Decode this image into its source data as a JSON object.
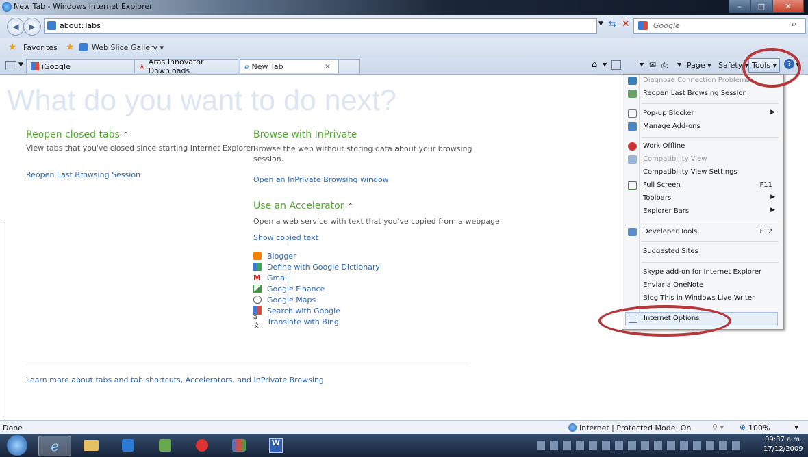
{
  "window": {
    "title": "New Tab - Windows Internet Explorer"
  },
  "address": {
    "url": "about:Tabs",
    "search_placeholder": "Google"
  },
  "favorites": {
    "favorites_label": "Favorites",
    "web_slice_label": "Web Slice Gallery ▾"
  },
  "tabs": [
    {
      "label": "iGoogle"
    },
    {
      "label": "Aras Innovator Downloads"
    },
    {
      "label": "New Tab"
    }
  ],
  "command_bar": {
    "page": "Page ▾",
    "safety": "Safety ▾",
    "tools": "Tools ▾"
  },
  "content": {
    "heading": "What do you want to do next?",
    "reopen": {
      "title": "Reopen closed tabs",
      "desc": "View tabs that you've closed since starting Internet Explorer.",
      "link": "Reopen Last Browsing Session"
    },
    "inprivate": {
      "title": "Browse with InPrivate",
      "desc1": "Browse the web without storing data about your browsing",
      "desc2": "session.",
      "link": "Open an InPrivate Browsing window"
    },
    "accelerator": {
      "title": "Use an Accelerator",
      "desc": "Open a web service with text that you've copied from a webpage.",
      "show_copied": "Show copied text",
      "items": [
        "Blogger",
        "Define with Google Dictionary",
        "Gmail",
        "Google Finance",
        "Google Maps",
        "Search with Google",
        "Translate with Bing"
      ]
    },
    "learn_more": "Learn more about tabs and tab shortcuts, Accelerators, and InPrivate Browsing"
  },
  "tools_menu": {
    "items": [
      {
        "label": "Diagnose Connection Problems...",
        "disabled": true
      },
      {
        "label": "Reopen Last Browsing Session"
      },
      {
        "label": "Pop-up Blocker",
        "submenu": true
      },
      {
        "label": "Manage Add-ons"
      },
      {
        "label": "Work Offline"
      },
      {
        "label": "Compatibility View",
        "disabled": true
      },
      {
        "label": "Compatibility View Settings"
      },
      {
        "label": "Full Screen",
        "key": "F11"
      },
      {
        "label": "Toolbars",
        "submenu": true
      },
      {
        "label": "Explorer Bars",
        "submenu": true
      },
      {
        "label": "Developer Tools",
        "key": "F12"
      },
      {
        "label": "Suggested Sites"
      },
      {
        "label": "Skype add-on for Internet Explorer"
      },
      {
        "label": "Enviar a OneNote"
      },
      {
        "label": "Blog This in Windows Live Writer"
      },
      {
        "label": "Internet Options"
      }
    ]
  },
  "status": {
    "left": "Done",
    "zone": "Internet | Protected Mode: On",
    "zoom": "100%"
  },
  "taskbar": {
    "time": "09:37 a.m.",
    "date": "17/12/2009"
  },
  "colors": {
    "accent_green": "#54a82f",
    "link_blue": "#2e68b4",
    "highlight_circle": "#b5383c"
  }
}
